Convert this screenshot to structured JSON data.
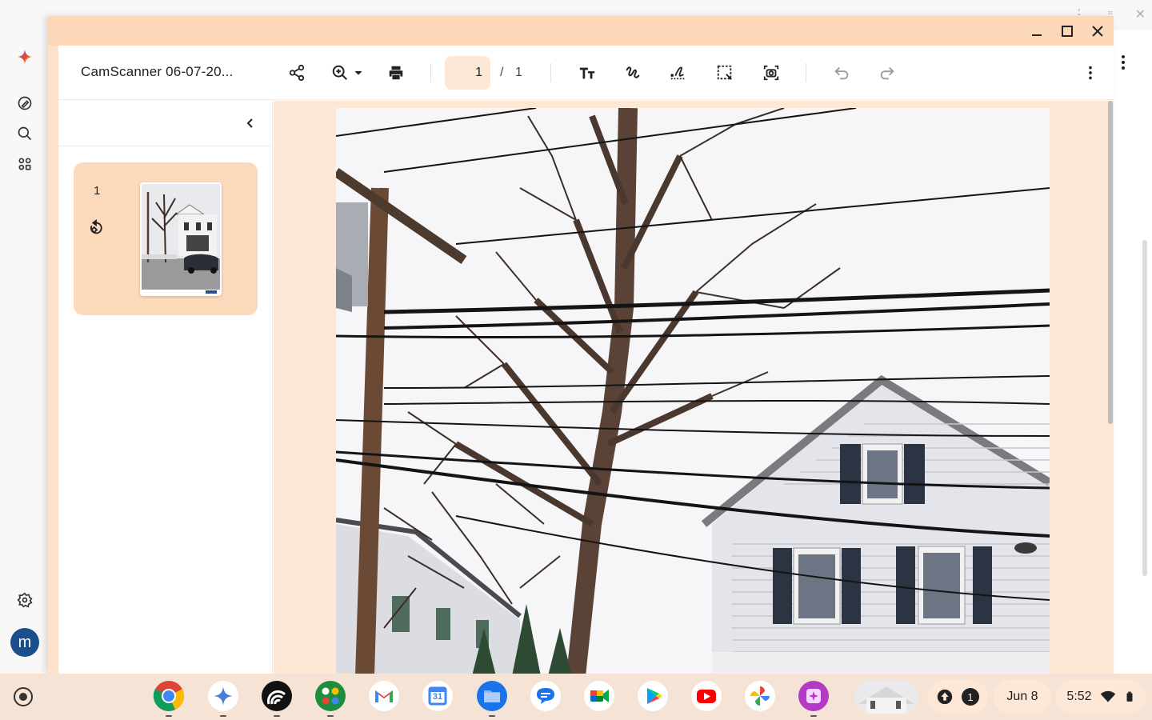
{
  "background_app": {
    "rail": {
      "icons": [
        "sparkle-icon",
        "edit-icon",
        "search-icon",
        "apps-icon",
        "gear-icon"
      ],
      "avatar_letter": "m"
    }
  },
  "window": {
    "doc_title": "CamScanner 06-07-20...",
    "controls": [
      "minimize-icon",
      "maximize-icon",
      "close-icon"
    ]
  },
  "toolbar": {
    "current_page": "1",
    "page_separator": "/",
    "total_pages": "1",
    "tools": [
      "share-icon",
      "zoom-in-icon",
      "print-icon",
      "text-icon",
      "draw-icon",
      "signature-icon",
      "select-area-icon",
      "screenshot-icon",
      "undo-icon",
      "redo-icon",
      "more-icon"
    ]
  },
  "sidebar": {
    "thumbnail_page_number": "1"
  },
  "taskbar": {
    "apps": [
      "Chrome",
      "Gemini",
      "Podcast",
      "Apps",
      "Gmail",
      "Calendar",
      "Files",
      "Messages",
      "Meet",
      "Play Store",
      "YouTube",
      "Photos",
      "Screencast"
    ],
    "calendar_day": "31",
    "notification_count": "1",
    "date": "Jun 8",
    "time": "5:52"
  },
  "colors": {
    "accent": "#fcd8b8",
    "card": "#fdd9bc",
    "docbg": "#fde8d6"
  }
}
